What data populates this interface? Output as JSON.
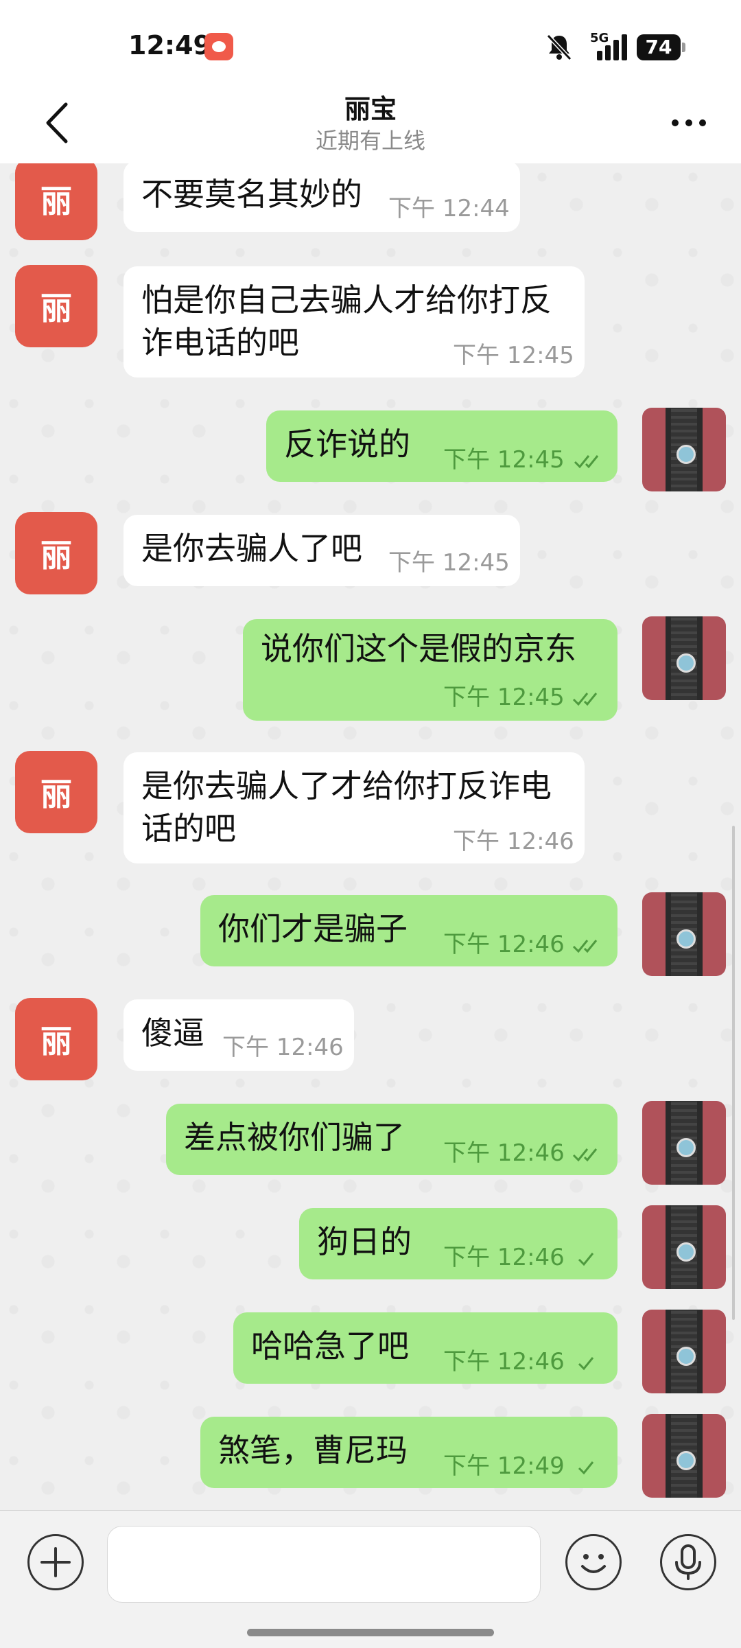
{
  "status_bar": {
    "time": "12:49",
    "network": "5G",
    "battery": "74"
  },
  "header": {
    "title": "丽宝",
    "subtitle": "近期有上线"
  },
  "contact": {
    "avatar_text": "丽"
  },
  "messages": [
    {
      "dir": "in",
      "text": "不要莫名其妙的",
      "time": "下午 12:44"
    },
    {
      "dir": "in",
      "text": "怕是你自己去骗人才给你打反诈电话的吧",
      "time": "下午 12:45"
    },
    {
      "dir": "out",
      "text": "反诈说的",
      "time": "下午 12:45",
      "read": "double"
    },
    {
      "dir": "in",
      "text": "是你去骗人了吧",
      "time": "下午 12:45"
    },
    {
      "dir": "out",
      "text": "说你们这个是假的京东",
      "time": "下午 12:45",
      "read": "double"
    },
    {
      "dir": "in",
      "text": "是你去骗人了才给你打反诈电话的吧",
      "time": "下午 12:46"
    },
    {
      "dir": "out",
      "text": "你们才是骗子",
      "time": "下午 12:46",
      "read": "double"
    },
    {
      "dir": "in",
      "text": "傻逼",
      "time": "下午 12:46"
    },
    {
      "dir": "out",
      "text": "差点被你们骗了",
      "time": "下午 12:46",
      "read": "double"
    },
    {
      "dir": "out",
      "text": "狗日的",
      "time": "下午 12:46",
      "read": "single"
    },
    {
      "dir": "out",
      "text": "哈哈急了吧",
      "time": "下午 12:46",
      "read": "single"
    },
    {
      "dir": "out",
      "text": "煞笔，曹尼玛",
      "time": "下午 12:49",
      "read": "single"
    }
  ],
  "colors": {
    "incoming_bubble": "#ffffff",
    "outgoing_bubble": "#a6ea8b",
    "avatar": "#e35a4b"
  },
  "icons": {
    "back": "chevron-left-icon",
    "more": "more-dots-icon",
    "attach": "plus-icon",
    "emoji": "emoji-icon",
    "voice": "microphone-icon"
  }
}
